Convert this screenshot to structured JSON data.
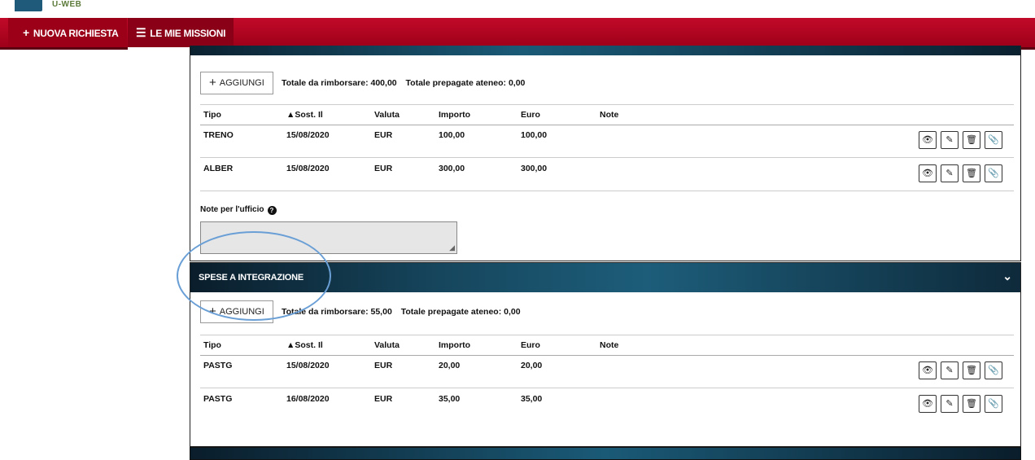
{
  "header": {
    "logo_text": "U-WEB"
  },
  "nav": {
    "new_request": {
      "icon": "plus-icon",
      "label": "NUOVA RICHIESTA"
    },
    "my_missions": {
      "icon": "list-icon",
      "label": "LE MIE MISSIONI"
    }
  },
  "colors": {
    "nav_bg": "#b0001f",
    "panel_dark": "#12394f",
    "annotation": "#6a9fd6"
  },
  "section1": {
    "add_label": "AGGIUNGI",
    "total_refund": "Totale da rimborsare: 400,00",
    "total_prepaid": "Totale prepagate ateneo: 0,00",
    "columns": [
      "Tipo",
      "▲Sost. Il",
      "Valuta",
      "Importo",
      "Euro",
      "Note"
    ],
    "rows": [
      [
        "TRENO",
        "15/08/2020",
        "EUR",
        "100,00",
        "100,00",
        ""
      ],
      [
        "ALBER",
        "15/08/2020",
        "EUR",
        "300,00",
        "300,00",
        ""
      ]
    ],
    "notes_label": "Note per l'ufficio",
    "notes_value": ""
  },
  "section2": {
    "title": "SPESE A INTEGRAZIONE",
    "add_label": "AGGIUNGI",
    "total_refund": "Totale da rimborsare: 55,00",
    "total_prepaid": "Totale prepagate ateneo: 0,00",
    "columns": [
      "Tipo",
      "▲Sost. Il",
      "Valuta",
      "Importo",
      "Euro",
      "Note"
    ],
    "rows": [
      [
        "PASTG",
        "15/08/2020",
        "EUR",
        "20,00",
        "20,00",
        ""
      ],
      [
        "PASTG",
        "16/08/2020",
        "EUR",
        "35,00",
        "35,00",
        ""
      ]
    ]
  },
  "row_actions": [
    "view-icon",
    "edit-icon",
    "delete-icon",
    "attach-icon"
  ]
}
